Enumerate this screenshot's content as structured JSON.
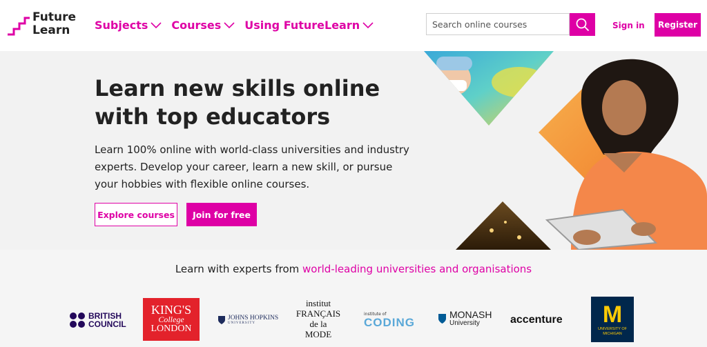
{
  "brand": {
    "logo_text_line1": "Future",
    "logo_text_line2": "Learn"
  },
  "nav": {
    "items": [
      {
        "label": "Subjects"
      },
      {
        "label": "Courses"
      },
      {
        "label": "Using FutureLearn"
      }
    ]
  },
  "search": {
    "placeholder": "Search online courses",
    "icon": "search-icon"
  },
  "auth": {
    "sign_in": "Sign in",
    "register": "Register"
  },
  "hero": {
    "title": "Learn new skills online with top educators",
    "subtitle": "Learn 100% online with world-class universities and industry experts. Develop your career, learn a new skill, or pursue your hobbies with flexible online courses.",
    "explore_button": "Explore courses",
    "join_button": "Join for free"
  },
  "partners": {
    "title_prefix": "Learn with experts from ",
    "title_link": "world-leading universities and organisations",
    "logos": {
      "british_council_line1": "BRITISH",
      "british_council_line2": "COUNCIL",
      "kings_line1": "KING'S",
      "kings_line2": "College",
      "kings_line3": "LONDON",
      "hopkins_line1": "JOHNS HOPKINS",
      "hopkins_line2": "UNIVERSITY",
      "ifm_line1": "institut",
      "ifm_line2": "FRANÇAIS",
      "ifm_line3": "de la",
      "ifm_line4": "MODE",
      "coding_line1": "institute of",
      "coding_line2": "CODING",
      "monash_line1": "MONASH",
      "monash_line2": "University",
      "accenture": "accenture",
      "michigan_letter": "M",
      "michigan_line1": "UNIVERSITY OF",
      "michigan_line2": "MICHIGAN"
    }
  },
  "colors": {
    "accent": "#de00a5",
    "hero_bg": "#f2f2f2",
    "partners_bg": "#f5f5f5",
    "orange": "#f59a4a"
  }
}
